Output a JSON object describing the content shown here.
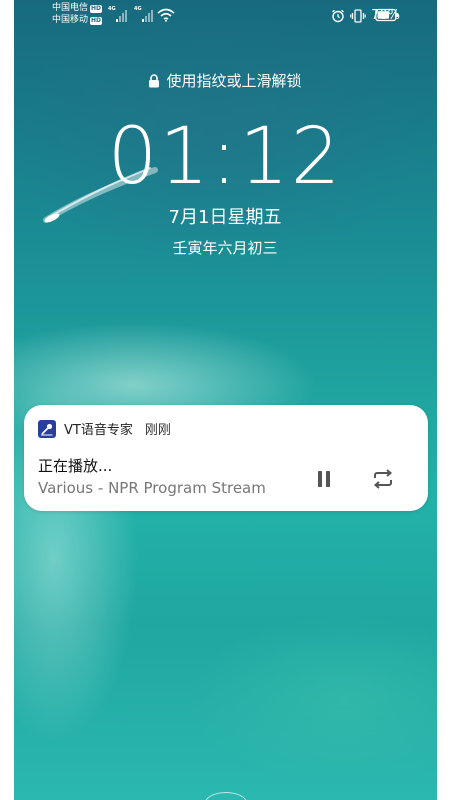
{
  "status_bar": {
    "carrier_1": "中国电信",
    "carrier_2": "中国移动",
    "hd_badge": "HD",
    "network_type": "4G",
    "battery_percent": "70%",
    "battery_level": 0.7
  },
  "lock": {
    "hint": "使用指纹或上滑解锁"
  },
  "clock": {
    "time": "01:12",
    "date": "7月1日星期五",
    "lunar_date": "壬寅年六月初三"
  },
  "notification": {
    "app_name": "VT语音专家",
    "time": "刚刚",
    "title": "正在播放...",
    "subtitle": "Various - NPR Program Stream",
    "icons": [
      "pause-icon",
      "repeat-icon"
    ]
  },
  "colors": {
    "accent": "#2a3f9c",
    "wallpaper_top": "#176a7e",
    "wallpaper_bottom": "#2bb8b0"
  }
}
